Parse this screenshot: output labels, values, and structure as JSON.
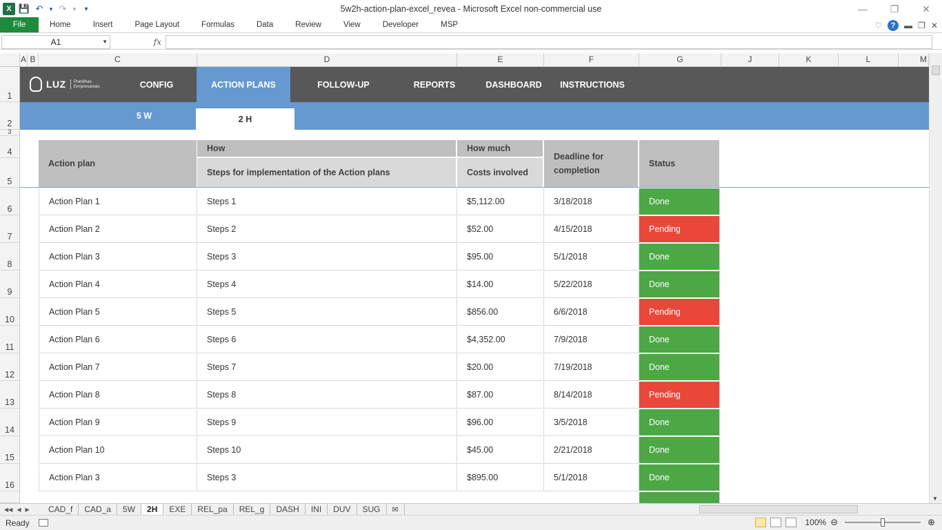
{
  "window": {
    "title": "5w2h-action-plan-excel_revea  -  Microsoft Excel non-commercial use"
  },
  "ribbon": {
    "tabs": [
      "File",
      "Home",
      "Insert",
      "Page Layout",
      "Formulas",
      "Data",
      "Review",
      "View",
      "Developer",
      "MSP"
    ]
  },
  "formula_bar": {
    "name_box": "A1",
    "fx_label": "fx",
    "formula": ""
  },
  "columns": [
    "A",
    "B",
    "C",
    "D",
    "E",
    "F",
    "G",
    "J",
    "K",
    "L",
    "M"
  ],
  "rows": [
    "1",
    "2",
    "3",
    "4",
    "5",
    "6",
    "7",
    "8",
    "9",
    "10",
    "11",
    "12",
    "13",
    "14",
    "15",
    "16"
  ],
  "nav": {
    "logo_text": "LUZ",
    "logo_sub1": "Planilhas",
    "logo_sub2": "Empresariais",
    "items": [
      "CONFIG",
      "ACTION PLANS",
      "FOLLOW-UP",
      "REPORTS",
      "DASHBOARD",
      "INSTRUCTIONS"
    ],
    "active": "ACTION PLANS",
    "sub_items": [
      "5 W",
      "2 H"
    ],
    "sub_active": "2 H"
  },
  "table": {
    "headers": {
      "action_plan": "Action plan",
      "how": "How",
      "how_sub": "Steps for implementation of the Action plans",
      "how_much": "How much",
      "how_much_sub": "Costs involved",
      "deadline": "Deadline for completion",
      "status": "Status"
    },
    "rows": [
      {
        "plan": "Action Plan 1",
        "steps": "Steps 1",
        "cost": "$5,112.00",
        "deadline": "3/18/2018",
        "status": "Done"
      },
      {
        "plan": "Action Plan 2",
        "steps": "Steps 2",
        "cost": "$52.00",
        "deadline": "4/15/2018",
        "status": "Pending"
      },
      {
        "plan": "Action Plan 3",
        "steps": "Steps 3",
        "cost": "$95.00",
        "deadline": "5/1/2018",
        "status": "Done"
      },
      {
        "plan": "Action Plan 4",
        "steps": "Steps 4",
        "cost": "$14.00",
        "deadline": "5/22/2018",
        "status": "Done"
      },
      {
        "plan": "Action Plan 5",
        "steps": "Steps 5",
        "cost": "$856.00",
        "deadline": "6/6/2018",
        "status": "Pending"
      },
      {
        "plan": "Action Plan 6",
        "steps": "Steps 6",
        "cost": "$4,352.00",
        "deadline": "7/9/2018",
        "status": "Done"
      },
      {
        "plan": "Action Plan 7",
        "steps": "Steps 7",
        "cost": "$20.00",
        "deadline": "7/19/2018",
        "status": "Done"
      },
      {
        "plan": "Action Plan 8",
        "steps": "Steps 8",
        "cost": "$87.00",
        "deadline": "8/14/2018",
        "status": "Pending"
      },
      {
        "plan": "Action Plan 9",
        "steps": "Steps 9",
        "cost": "$96.00",
        "deadline": "3/5/2018",
        "status": "Done"
      },
      {
        "plan": "Action Plan 10",
        "steps": "Steps 10",
        "cost": "$45.00",
        "deadline": "2/21/2018",
        "status": "Done"
      },
      {
        "plan": "Action Plan 3",
        "steps": "Steps 3",
        "cost": "$895.00",
        "deadline": "5/1/2018",
        "status": "Done"
      }
    ]
  },
  "colors": {
    "done": "#4ca845",
    "pending": "#e8473a",
    "nav_bg": "#585858",
    "accent": "#6599cf",
    "file_tab": "#1f8a3b"
  },
  "sheet_tabs": [
    "CAD_f",
    "CAD_a",
    "5W",
    "2H",
    "EXE",
    "REL_pa",
    "REL_g",
    "DASH",
    "INI",
    "DUV",
    "SUG"
  ],
  "active_sheet": "2H",
  "status_bar": {
    "ready": "Ready",
    "zoom": "100%"
  }
}
